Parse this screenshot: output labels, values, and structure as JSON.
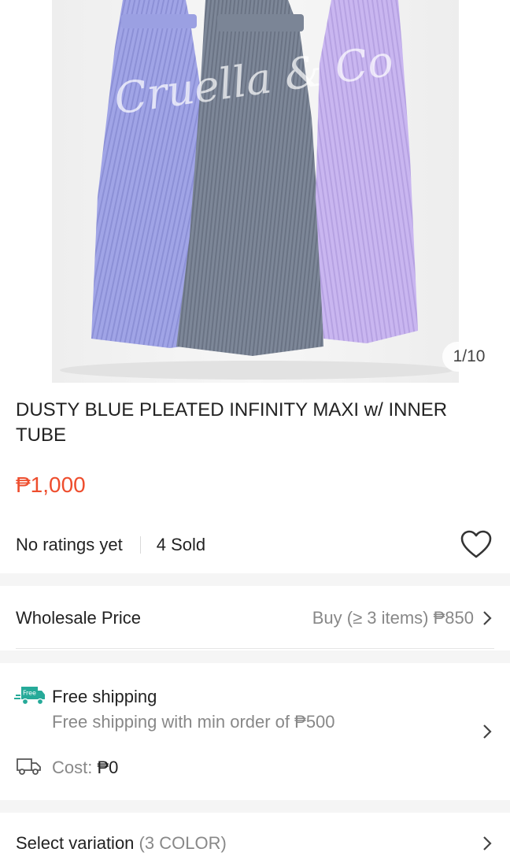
{
  "gallery": {
    "counter": "1/10",
    "watermark": "Cruella & Co"
  },
  "product": {
    "title": "DUSTY BLUE PLEATED INFINITY MAXI w/ INNER TUBE",
    "price": "₱1,000",
    "ratings": "No ratings yet",
    "sold": "4 Sold"
  },
  "wholesale": {
    "label": "Wholesale Price",
    "value": "Buy (≥ 3 items) ₱850"
  },
  "shipping": {
    "badge": "Free",
    "title": "Free shipping",
    "subtitle": "Free shipping with min order of ₱500",
    "cost_label": "Cost: ",
    "cost_value": "₱0"
  },
  "variation": {
    "label": "Select variation",
    "extra": "(3 COLOR)"
  },
  "colors": {
    "accent": "#ee4d2d",
    "shipping_icon": "#26aa99"
  }
}
